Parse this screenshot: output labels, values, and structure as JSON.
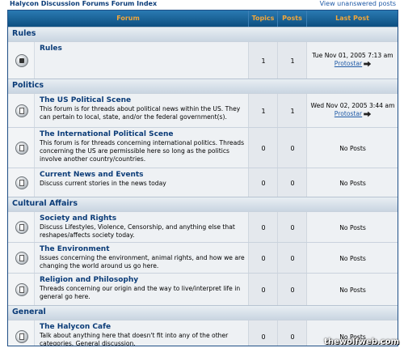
{
  "page_title": "Halycon Discussion Forums Forum Index",
  "unanswered_link": "View unanswered posts",
  "header": {
    "forum": "Forum",
    "topics": "Topics",
    "posts": "Posts",
    "last_post": "Last Post"
  },
  "categories": {
    "rules": "Rules",
    "politics": "Politics",
    "cultural": "Cultural Affairs",
    "general": "General"
  },
  "forums": [
    {
      "name": "Rules",
      "desc": "",
      "topics": "1",
      "posts": "1",
      "last_date": "Tue Nov 01, 2005 7:13 am",
      "last_user": "Protostar",
      "icon": "lock-icon"
    },
    {
      "name": "The US Political Scene",
      "desc": "This forum is for threads about political news within the US. They can pertain to local, state, and/or the federal government(s).",
      "topics": "1",
      "posts": "1",
      "last_date": "Wed Nov 02, 2005 3:44 am",
      "last_user": "Protostar",
      "icon": "folder-icon"
    },
    {
      "name": "The International Political Scene",
      "desc": "This forum is for threads concerning international politics. Threads concerning the US are permissible here so long as the politics involve another country/countries.",
      "topics": "0",
      "posts": "0",
      "last_text": "No Posts",
      "icon": "folder-icon"
    },
    {
      "name": "Current News and Events",
      "desc": "Discuss current stories in the news today",
      "topics": "0",
      "posts": "0",
      "last_text": "No Posts",
      "icon": "folder-icon"
    },
    {
      "name": "Society and Rights",
      "desc": "Discuss Lifestyles, Violence, Censorship, and anything else that reshapes/affects society today.",
      "topics": "0",
      "posts": "0",
      "last_text": "No Posts",
      "icon": "folder-icon"
    },
    {
      "name": "The Environment",
      "desc": "Issues concerning the environment, animal rights, and how we are changing the world around us go here.",
      "topics": "0",
      "posts": "0",
      "last_text": "No Posts",
      "icon": "folder-icon"
    },
    {
      "name": "Religion and Philosophy",
      "desc": "Threads concerning our origin and the way to live/interpret life in general go here.",
      "topics": "0",
      "posts": "0",
      "last_text": "No Posts",
      "icon": "folder-icon"
    },
    {
      "name": "The Halycon Cafe",
      "desc": "Talk about anything here that doesn't fit into any of the other categories. General discussion.",
      "topics": "0",
      "posts": "0",
      "last_text": "No Posts",
      "icon": "folder-icon"
    }
  ],
  "watermark": "thewolfweb.com",
  "colors": {
    "header_bg": "#0d4f80",
    "header_text": "#f2a73a",
    "link": "#0b3c78",
    "category_bg": "#d9e1ea"
  }
}
